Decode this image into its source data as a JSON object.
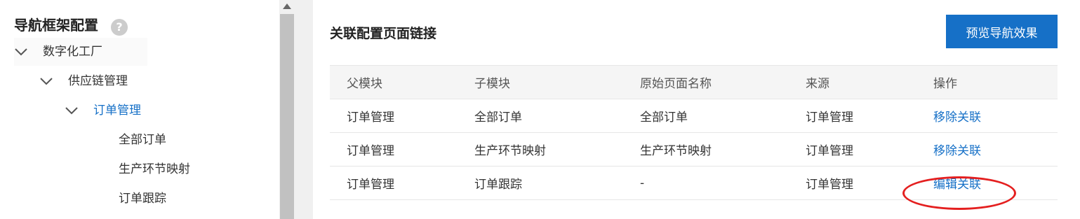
{
  "sidebar": {
    "title": "导航框架配置",
    "help_icon": "?",
    "tree": {
      "level0": "数字化工厂",
      "level1": "供应链管理",
      "level2": "订单管理",
      "leaves": [
        "全部订单",
        "生产环节映射",
        "订单跟踪"
      ]
    }
  },
  "main": {
    "title": "关联配置页面链接",
    "preview_button": "预览导航效果",
    "table": {
      "headers": [
        "父模块",
        "子模块",
        "原始页面名称",
        "来源",
        "操作"
      ],
      "rows": [
        {
          "parent": "订单管理",
          "child": "全部订单",
          "original": "全部订单",
          "source": "订单管理",
          "action": "移除关联"
        },
        {
          "parent": "订单管理",
          "child": "生产环节映射",
          "original": "生产环节映射",
          "source": "订单管理",
          "action": "移除关联"
        },
        {
          "parent": "订单管理",
          "child": "订单跟踪",
          "original": "-",
          "source": "订单管理",
          "action": "编辑关联"
        }
      ]
    }
  },
  "colors": {
    "accent": "#1670c7",
    "highlight": "#e41f1f",
    "header_bg": "#f5f5f5",
    "scroll_thumb": "#c1c1c1"
  },
  "icons": [
    "help-icon",
    "chevron-down-icon",
    "scroll-up-arrow-icon"
  ]
}
